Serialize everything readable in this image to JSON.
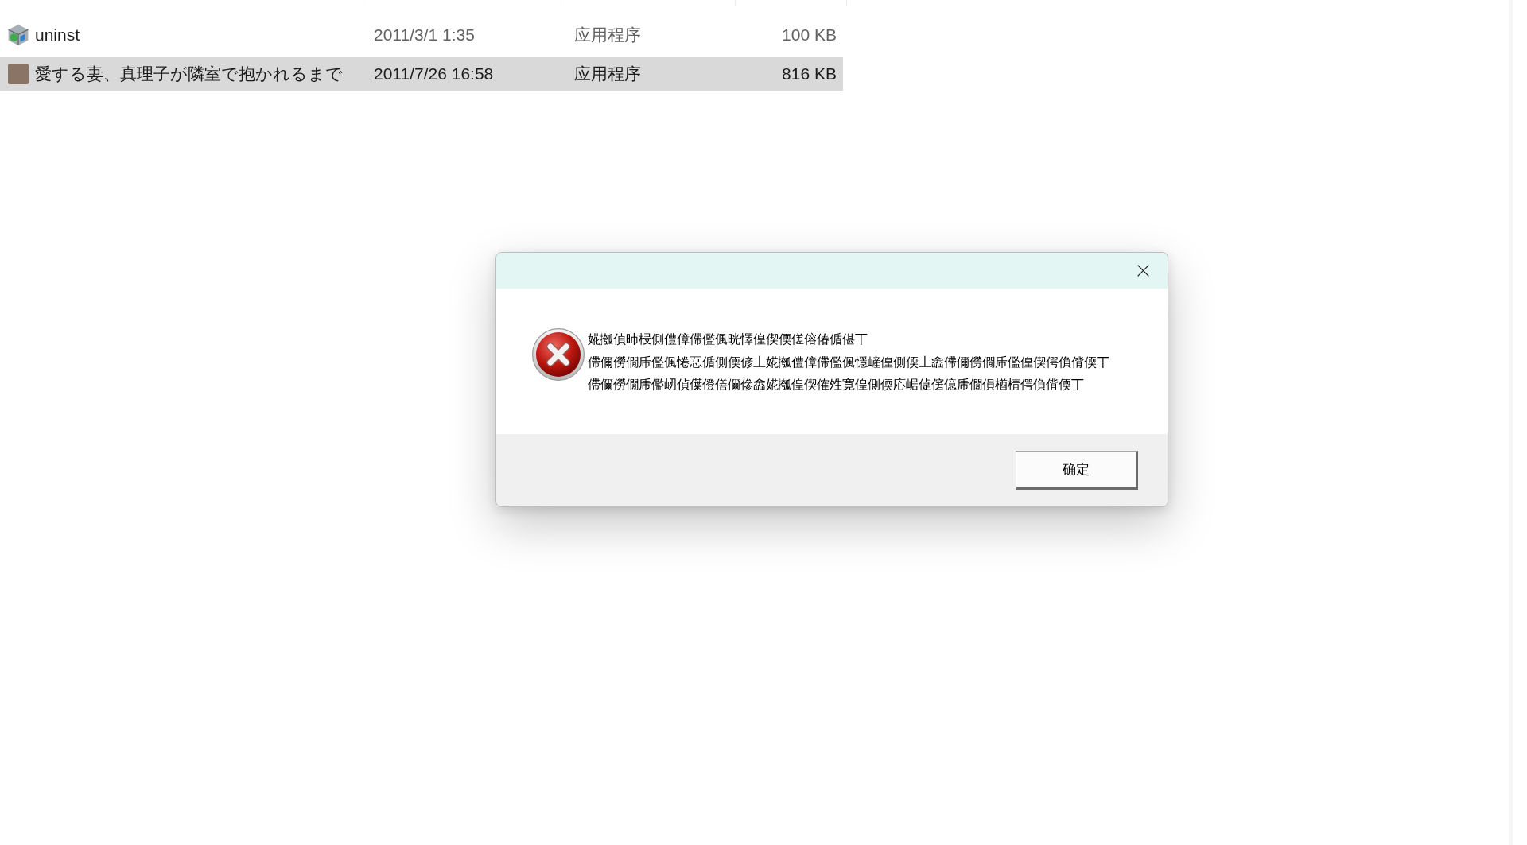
{
  "file_list": {
    "rows": [
      {
        "kind": "installer",
        "name": "uninst",
        "date": "2011/3/1 1:35",
        "type": "应用程序",
        "size": "100 KB",
        "selected": false
      },
      {
        "kind": "picture",
        "name": "愛する妻、真理子が隣室で抱かれるまで",
        "date": "2011/7/26 16:58",
        "type": "应用程序",
        "size": "816 KB",
        "selected": true
      }
    ]
  },
  "dialog": {
    "kind": "error",
    "message_lines": [
      "婲摦偵昁梫側僼傽僀儖偑晄懌偟偰偄傞傛偆偱偡丅",
      "僀儞僗僩乕儖偑惓忢偱側偄偐丄婲摦僼傽僀儖偑懚嵼偟側偄丄嵞僀儞僗僩乕儖偟偰偔偩偝偄丅",
      "僀儞僗僩乕儖屻偵僷僜僐儞傪嵞婲摦偟偰傕夝寛偟側偄応崌偼僒億乕僩傊楢棈偔偩偝偄丅"
    ],
    "buttons": [
      {
        "label": "确定"
      }
    ]
  }
}
